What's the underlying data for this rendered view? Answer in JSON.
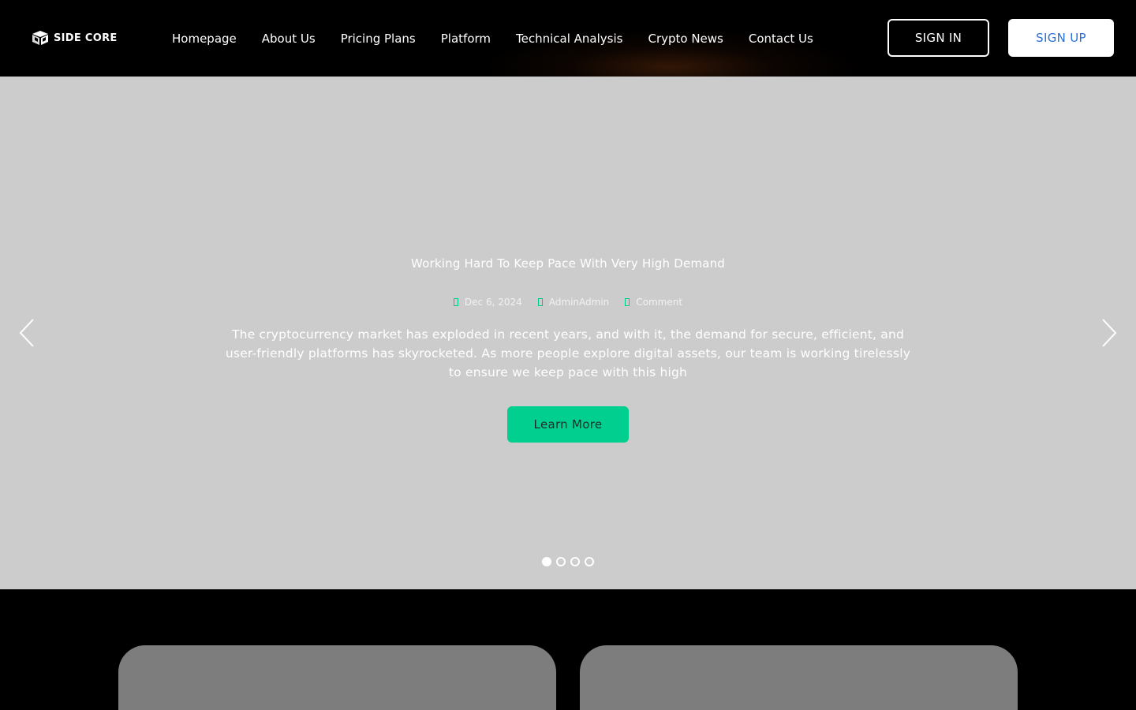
{
  "brand": {
    "name": "SIDE CORE"
  },
  "nav": {
    "items": [
      {
        "label": "Homepage"
      },
      {
        "label": "About Us"
      },
      {
        "label": "Pricing Plans"
      },
      {
        "label": "Platform"
      },
      {
        "label": "Technical Analysis"
      },
      {
        "label": "Crypto News"
      },
      {
        "label": "Contact Us"
      }
    ]
  },
  "auth": {
    "signin_label": "SIGN IN",
    "signup_label": "SIGN UP"
  },
  "slider": {
    "title": "Working Hard To Keep Pace With Very High Demand",
    "meta": {
      "date": "Dec 6, 2024",
      "author": "AdminAdmin",
      "comment": "Comment"
    },
    "description": "The cryptocurrency market has exploded in recent years, and with it, the demand for secure, efficient, and user-friendly platforms has skyrocketed. As more people explore digital assets, our team is working tirelessly to ensure we keep pace with this high",
    "cta_label": "Learn More",
    "slide_count": 4,
    "active_slide": 1,
    "icons": {
      "prev": "chevron-left-icon",
      "next": "chevron-right-icon"
    }
  },
  "colors": {
    "accent": "#00cf8f",
    "signup_text": "#2b6fd6",
    "hero_bg": "#cccccc",
    "card_bg": "#7d7d7d"
  }
}
